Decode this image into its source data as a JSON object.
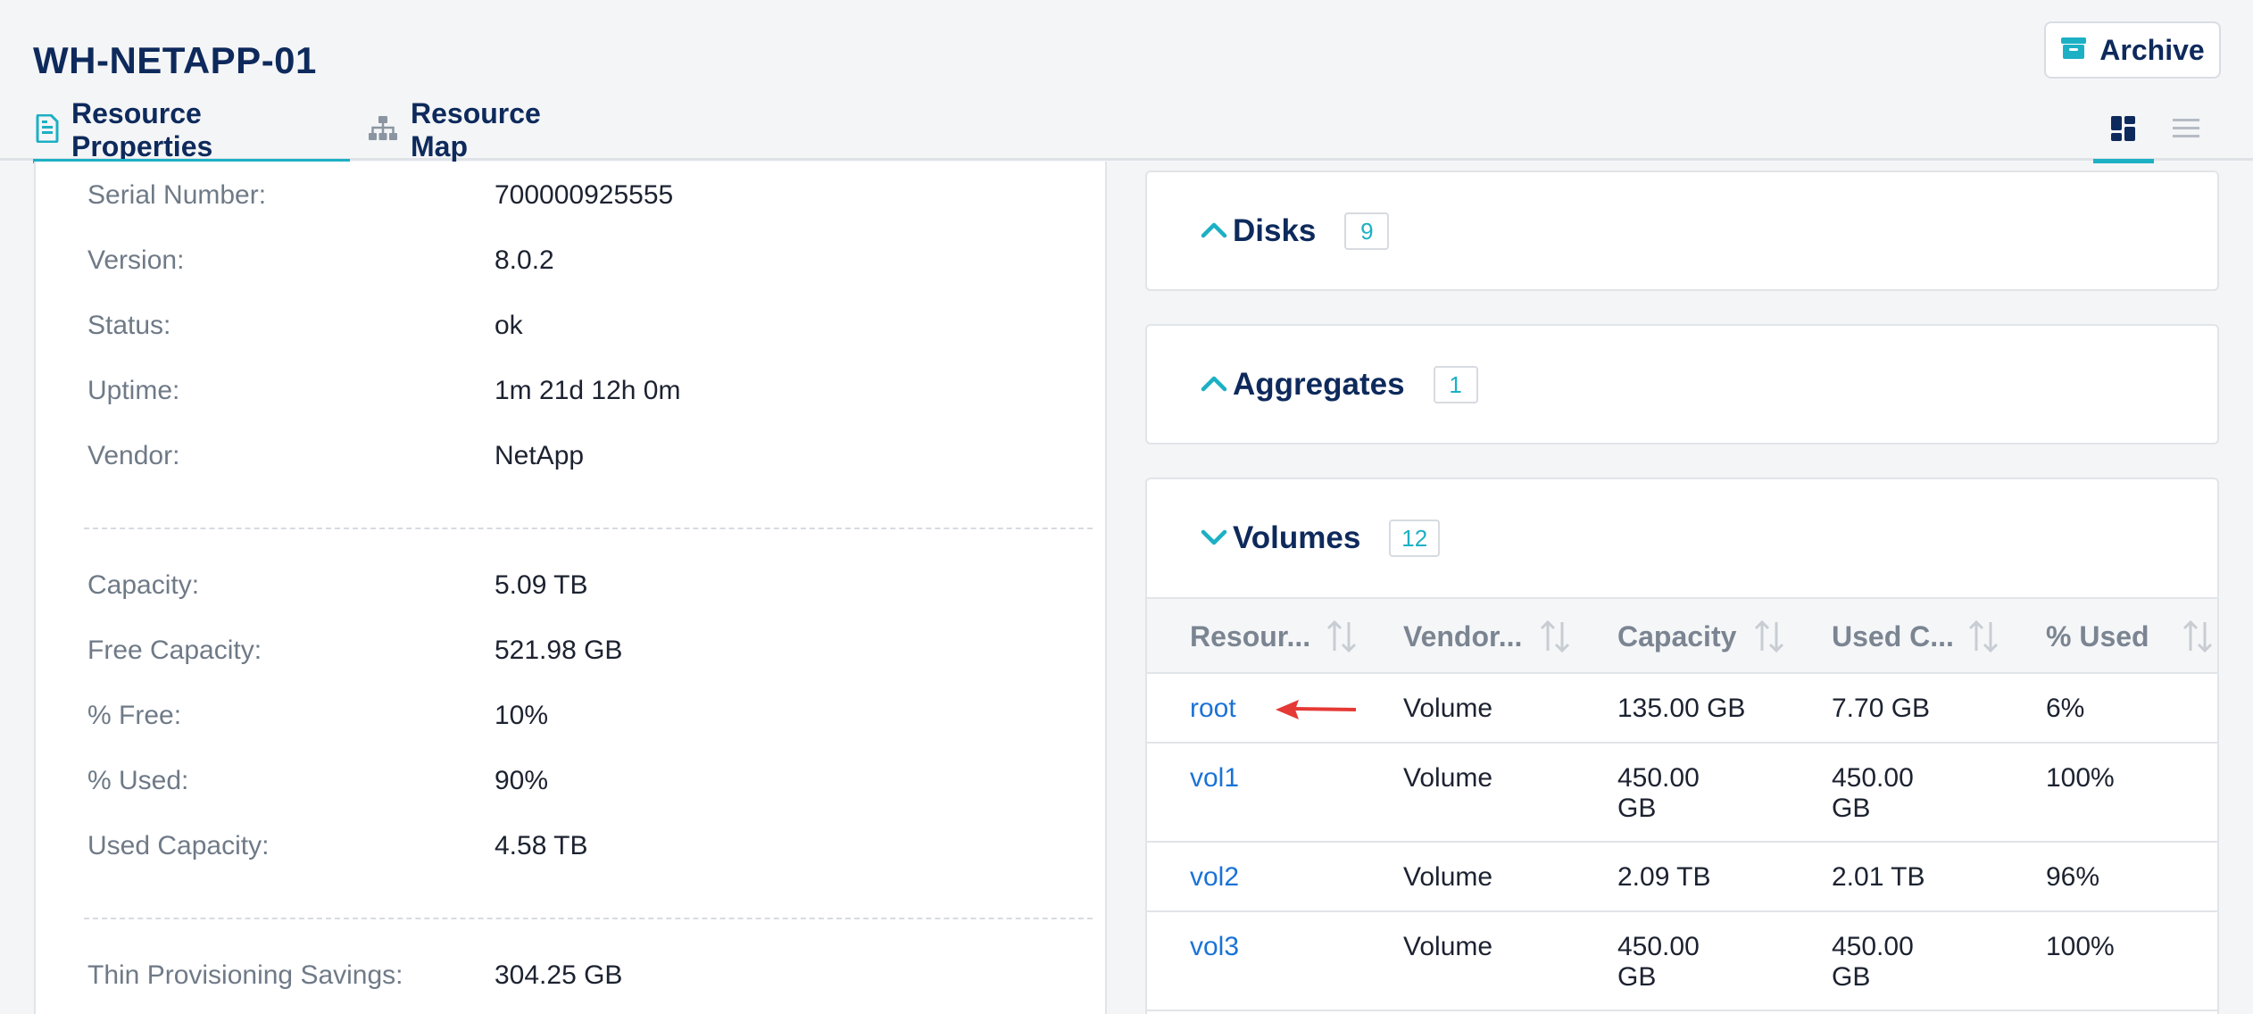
{
  "header": {
    "title": "WH-NETAPP-01",
    "archive_label": "Archive",
    "tabs": [
      {
        "label": "Resource Properties",
        "active": true
      },
      {
        "label": "Resource Map",
        "active": false
      }
    ],
    "accent_color": "#1cb0c4",
    "title_color": "#0e2a5c"
  },
  "properties": {
    "general": [
      {
        "label": "Serial Number:",
        "value": "700000925555"
      },
      {
        "label": "Version:",
        "value": "8.0.2"
      },
      {
        "label": "Status:",
        "value": "ok"
      },
      {
        "label": "Uptime:",
        "value": "1m 21d 12h 0m"
      },
      {
        "label": "Vendor:",
        "value": "NetApp"
      }
    ],
    "capacity": [
      {
        "label": "Capacity:",
        "value": "5.09 TB"
      },
      {
        "label": "Free Capacity:",
        "value": "521.98 GB"
      },
      {
        "label": "% Free:",
        "value": "10%"
      },
      {
        "label": "% Used:",
        "value": "90%"
      },
      {
        "label": "Used Capacity:",
        "value": "4.58 TB"
      }
    ],
    "savings": [
      {
        "label": "Thin Provisioning Savings:",
        "value": "304.25 GB"
      }
    ]
  },
  "sections": {
    "disks": {
      "title": "Disks",
      "count": "9",
      "expanded": false
    },
    "aggregates": {
      "title": "Aggregates",
      "count": "1",
      "expanded": false
    },
    "volumes": {
      "title": "Volumes",
      "count": "12",
      "expanded": true,
      "columns": [
        "Resour...",
        "Vendor...",
        "Capacity",
        "Used C...",
        "% Used"
      ],
      "rows": [
        {
          "name": "root",
          "vendor": "Volume",
          "capacity": [
            "135.00 GB"
          ],
          "used": [
            "7.70 GB"
          ],
          "pct": "6%"
        },
        {
          "name": "vol1",
          "vendor": "Volume",
          "capacity": [
            "450.00",
            "GB"
          ],
          "used": [
            "450.00",
            "GB"
          ],
          "pct": "100%"
        },
        {
          "name": "vol2",
          "vendor": "Volume",
          "capacity": [
            "2.09 TB"
          ],
          "used": [
            "2.01 TB"
          ],
          "pct": "96%"
        },
        {
          "name": "vol3",
          "vendor": "Volume",
          "capacity": [
            "450.00",
            "GB"
          ],
          "used": [
            "450.00",
            "GB"
          ],
          "pct": "100%"
        }
      ]
    }
  },
  "annotation": {
    "icon": "red-arrow-icon",
    "color": "#e53935"
  }
}
